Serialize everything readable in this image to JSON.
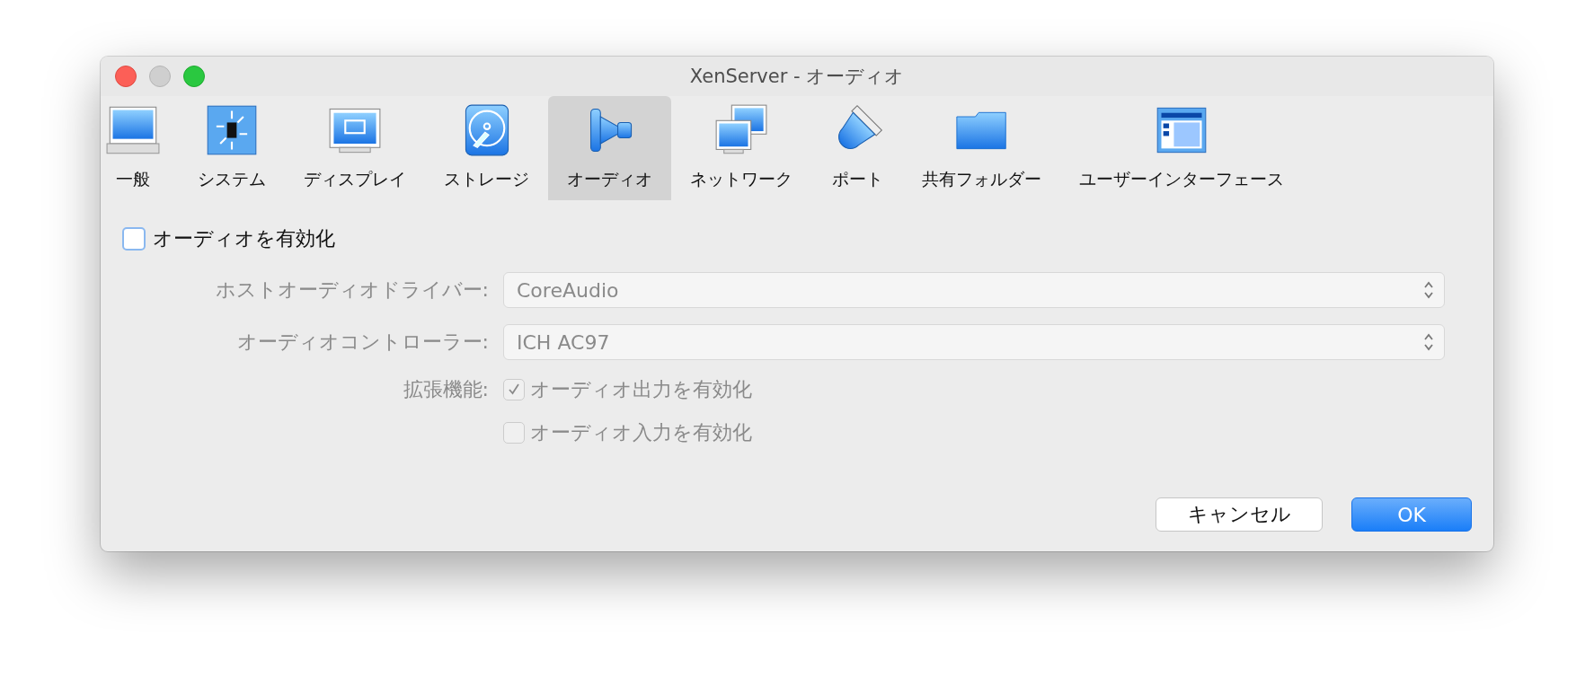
{
  "window": {
    "title": "XenServer - オーディオ"
  },
  "tabs": [
    {
      "label": "一般",
      "kind": "laptop",
      "selected": false
    },
    {
      "label": "システム",
      "kind": "chip",
      "selected": false
    },
    {
      "label": "ディスプレイ",
      "kind": "monitor",
      "selected": false
    },
    {
      "label": "ストレージ",
      "kind": "disk",
      "selected": false
    },
    {
      "label": "オーディオ",
      "kind": "speaker",
      "selected": true
    },
    {
      "label": "ネットワーク",
      "kind": "network",
      "selected": false
    },
    {
      "label": "ポート",
      "kind": "port",
      "selected": false
    },
    {
      "label": "共有フォルダー",
      "kind": "folder",
      "selected": false
    },
    {
      "label": "ユーザーインターフェース",
      "kind": "window",
      "selected": false
    }
  ],
  "enable_audio": {
    "label": "オーディオを有効化",
    "checked": false
  },
  "fields": [
    {
      "label": "ホストオーディオドライバー:",
      "value": "CoreAudio",
      "disabled": true
    },
    {
      "label": "オーディオコントローラー:",
      "value": "ICH AC97",
      "disabled": true
    }
  ],
  "extended": {
    "label": "拡張機能:",
    "options": [
      {
        "label": "オーディオ出力を有効化",
        "checked": true,
        "disabled": true
      },
      {
        "label": "オーディオ入力を有効化",
        "checked": false,
        "disabled": true
      }
    ]
  },
  "buttons": [
    {
      "label": "キャンセル",
      "kind": "secondary"
    },
    {
      "label": "OK",
      "kind": "primary"
    }
  ]
}
